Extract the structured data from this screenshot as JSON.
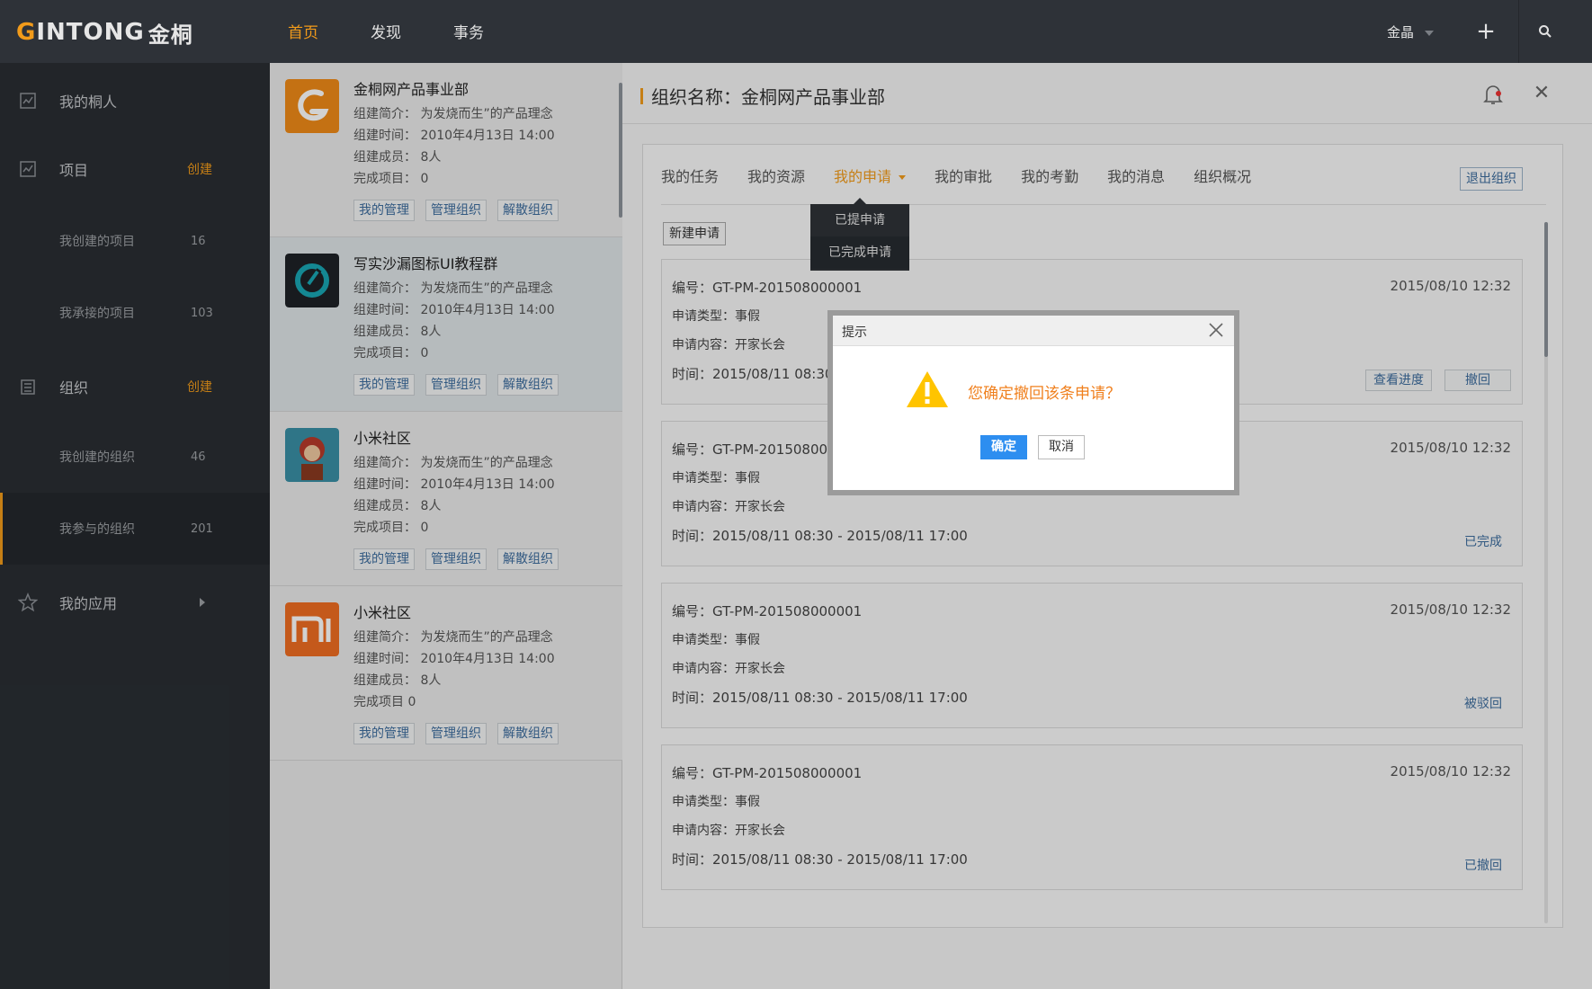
{
  "app": {
    "logo_letter": "G",
    "logo_text": "INTONG",
    "logo_cn": "金桐",
    "nav": [
      "首页",
      "发现",
      "事务"
    ],
    "user": "金晶"
  },
  "sidebar": {
    "items": [
      {
        "label": "我的桐人"
      },
      {
        "label": "项目",
        "action": "创建"
      },
      {
        "label": "我创建的项目",
        "count": "16"
      },
      {
        "label": "我承接的项目",
        "count": "103"
      },
      {
        "label": "组织",
        "action": "创建"
      },
      {
        "label": "我创建的组织",
        "count": "46"
      },
      {
        "label": "我参与的组织",
        "count": "201"
      },
      {
        "label": "我的应用"
      }
    ]
  },
  "orgs": [
    {
      "name": "金桐网产品事业部",
      "intro_k": "组建简介：",
      "intro_v": "为发烧而生”的产品理念",
      "time_k": "组建时间：",
      "time_v": "2010年4月13日  14:00",
      "members_k": "组建成员：",
      "members_v": "8人",
      "done_k": "完成项目：",
      "done_v": "0"
    },
    {
      "name": "写实沙漏图标UI教程群",
      "intro_k": "组建简介：",
      "intro_v": "为发烧而生”的产品理念",
      "time_k": "组建时间：",
      "time_v": "2010年4月13日  14:00",
      "members_k": "组建成员：",
      "members_v": "8人",
      "done_k": "完成项目：",
      "done_v": "0"
    },
    {
      "name": "小米社区",
      "intro_k": "组建简介：",
      "intro_v": "为发烧而生”的产品理念",
      "time_k": "组建时间：",
      "time_v": "2010年4月13日  14:00",
      "members_k": "组建成员：",
      "members_v": "8人",
      "done_k": "完成项目：",
      "done_v": "0"
    },
    {
      "name": "小米社区",
      "intro_k": "组建简介：",
      "intro_v": "为发烧而生”的产品理念",
      "time_k": "组建时间：",
      "time_v": "2010年4月13日  14:00",
      "members_k": "组建成员：",
      "members_v": "8人",
      "done_k": "完成项目",
      "done_v": "0"
    }
  ],
  "org_buttons": [
    "我的管理",
    "管理组织",
    "解散组织"
  ],
  "panel": {
    "title": "组织名称：金桐网产品事业部",
    "tabs": [
      "我的任务",
      "我的资源",
      "我的申请",
      "我的审批",
      "我的考勤",
      "我的消息",
      "组织概况"
    ],
    "quit_label": "退出组织",
    "new_label": "新建申请",
    "dropdown": [
      "已提申请",
      "已完成申请"
    ]
  },
  "requests": [
    {
      "no": "编号：GT-PM-201508000001",
      "date": "2015/08/10    12:32",
      "type": "申请类型：事假",
      "content": "申请内容：开家长会",
      "time": "时间：2015/08/11  08:30 - 2015/08/11  17:00",
      "status": "",
      "btn1": "查看进度",
      "btn2": "撤回"
    },
    {
      "no": "编号：GT-PM-201508000001",
      "date": "2015/08/10    12:32",
      "type": "申请类型：事假",
      "content": "申请内容：开家长会",
      "time": "时间：2015/08/11  08:30 - 2015/08/11  17:00",
      "status": "已完成"
    },
    {
      "no": "编号：GT-PM-201508000001",
      "date": "2015/08/10    12:32",
      "type": "申请类型：事假",
      "content": "申请内容：开家长会",
      "time": "时间：2015/08/11  08:30 - 2015/08/11  17:00",
      "status": "被驳回"
    },
    {
      "no": "编号：GT-PM-201508000001",
      "date": "2015/08/10    12:32",
      "type": "申请类型：事假",
      "content": "申请内容：开家长会",
      "time": "时间：2015/08/11  08:30 - 2015/08/11  17:00",
      "status": "已撤回"
    }
  ],
  "modal": {
    "title": "提示",
    "message": "您确定撤回该条申请？",
    "ok": "确定",
    "cancel": "取消"
  },
  "colors": {
    "accent": "#f29b1a",
    "link": "#3d6d9e",
    "primary_btn": "#2d8ef0"
  }
}
